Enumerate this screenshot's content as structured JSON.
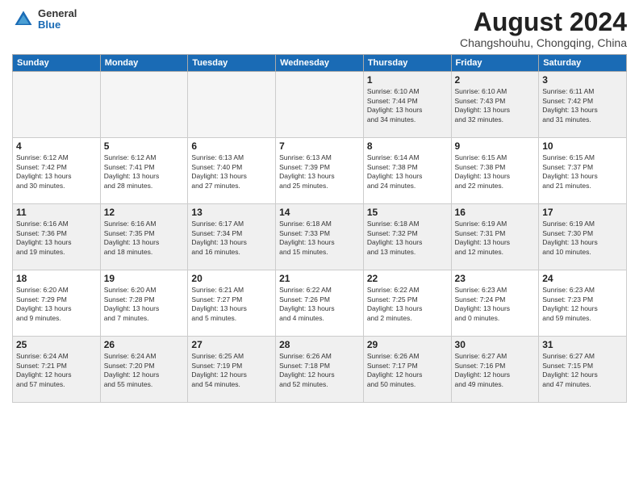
{
  "logo": {
    "general": "General",
    "blue": "Blue"
  },
  "title": "August 2024",
  "subtitle": "Changshouhu, Chongqing, China",
  "days_of_week": [
    "Sunday",
    "Monday",
    "Tuesday",
    "Wednesday",
    "Thursday",
    "Friday",
    "Saturday"
  ],
  "weeks": [
    {
      "id": "week1",
      "days": [
        {
          "num": "",
          "info": "",
          "empty": true
        },
        {
          "num": "",
          "info": "",
          "empty": true
        },
        {
          "num": "",
          "info": "",
          "empty": true
        },
        {
          "num": "",
          "info": "",
          "empty": true
        },
        {
          "num": "1",
          "info": "Sunrise: 6:10 AM\nSunset: 7:44 PM\nDaylight: 13 hours\nand 34 minutes.",
          "empty": false
        },
        {
          "num": "2",
          "info": "Sunrise: 6:10 AM\nSunset: 7:43 PM\nDaylight: 13 hours\nand 32 minutes.",
          "empty": false
        },
        {
          "num": "3",
          "info": "Sunrise: 6:11 AM\nSunset: 7:42 PM\nDaylight: 13 hours\nand 31 minutes.",
          "empty": false
        }
      ]
    },
    {
      "id": "week2",
      "days": [
        {
          "num": "4",
          "info": "Sunrise: 6:12 AM\nSunset: 7:42 PM\nDaylight: 13 hours\nand 30 minutes.",
          "empty": false
        },
        {
          "num": "5",
          "info": "Sunrise: 6:12 AM\nSunset: 7:41 PM\nDaylight: 13 hours\nand 28 minutes.",
          "empty": false
        },
        {
          "num": "6",
          "info": "Sunrise: 6:13 AM\nSunset: 7:40 PM\nDaylight: 13 hours\nand 27 minutes.",
          "empty": false
        },
        {
          "num": "7",
          "info": "Sunrise: 6:13 AM\nSunset: 7:39 PM\nDaylight: 13 hours\nand 25 minutes.",
          "empty": false
        },
        {
          "num": "8",
          "info": "Sunrise: 6:14 AM\nSunset: 7:38 PM\nDaylight: 13 hours\nand 24 minutes.",
          "empty": false
        },
        {
          "num": "9",
          "info": "Sunrise: 6:15 AM\nSunset: 7:38 PM\nDaylight: 13 hours\nand 22 minutes.",
          "empty": false
        },
        {
          "num": "10",
          "info": "Sunrise: 6:15 AM\nSunset: 7:37 PM\nDaylight: 13 hours\nand 21 minutes.",
          "empty": false
        }
      ]
    },
    {
      "id": "week3",
      "days": [
        {
          "num": "11",
          "info": "Sunrise: 6:16 AM\nSunset: 7:36 PM\nDaylight: 13 hours\nand 19 minutes.",
          "empty": false
        },
        {
          "num": "12",
          "info": "Sunrise: 6:16 AM\nSunset: 7:35 PM\nDaylight: 13 hours\nand 18 minutes.",
          "empty": false
        },
        {
          "num": "13",
          "info": "Sunrise: 6:17 AM\nSunset: 7:34 PM\nDaylight: 13 hours\nand 16 minutes.",
          "empty": false
        },
        {
          "num": "14",
          "info": "Sunrise: 6:18 AM\nSunset: 7:33 PM\nDaylight: 13 hours\nand 15 minutes.",
          "empty": false
        },
        {
          "num": "15",
          "info": "Sunrise: 6:18 AM\nSunset: 7:32 PM\nDaylight: 13 hours\nand 13 minutes.",
          "empty": false
        },
        {
          "num": "16",
          "info": "Sunrise: 6:19 AM\nSunset: 7:31 PM\nDaylight: 13 hours\nand 12 minutes.",
          "empty": false
        },
        {
          "num": "17",
          "info": "Sunrise: 6:19 AM\nSunset: 7:30 PM\nDaylight: 13 hours\nand 10 minutes.",
          "empty": false
        }
      ]
    },
    {
      "id": "week4",
      "days": [
        {
          "num": "18",
          "info": "Sunrise: 6:20 AM\nSunset: 7:29 PM\nDaylight: 13 hours\nand 9 minutes.",
          "empty": false
        },
        {
          "num": "19",
          "info": "Sunrise: 6:20 AM\nSunset: 7:28 PM\nDaylight: 13 hours\nand 7 minutes.",
          "empty": false
        },
        {
          "num": "20",
          "info": "Sunrise: 6:21 AM\nSunset: 7:27 PM\nDaylight: 13 hours\nand 5 minutes.",
          "empty": false
        },
        {
          "num": "21",
          "info": "Sunrise: 6:22 AM\nSunset: 7:26 PM\nDaylight: 13 hours\nand 4 minutes.",
          "empty": false
        },
        {
          "num": "22",
          "info": "Sunrise: 6:22 AM\nSunset: 7:25 PM\nDaylight: 13 hours\nand 2 minutes.",
          "empty": false
        },
        {
          "num": "23",
          "info": "Sunrise: 6:23 AM\nSunset: 7:24 PM\nDaylight: 13 hours\nand 0 minutes.",
          "empty": false
        },
        {
          "num": "24",
          "info": "Sunrise: 6:23 AM\nSunset: 7:23 PM\nDaylight: 12 hours\nand 59 minutes.",
          "empty": false
        }
      ]
    },
    {
      "id": "week5",
      "days": [
        {
          "num": "25",
          "info": "Sunrise: 6:24 AM\nSunset: 7:21 PM\nDaylight: 12 hours\nand 57 minutes.",
          "empty": false
        },
        {
          "num": "26",
          "info": "Sunrise: 6:24 AM\nSunset: 7:20 PM\nDaylight: 12 hours\nand 55 minutes.",
          "empty": false
        },
        {
          "num": "27",
          "info": "Sunrise: 6:25 AM\nSunset: 7:19 PM\nDaylight: 12 hours\nand 54 minutes.",
          "empty": false
        },
        {
          "num": "28",
          "info": "Sunrise: 6:26 AM\nSunset: 7:18 PM\nDaylight: 12 hours\nand 52 minutes.",
          "empty": false
        },
        {
          "num": "29",
          "info": "Sunrise: 6:26 AM\nSunset: 7:17 PM\nDaylight: 12 hours\nand 50 minutes.",
          "empty": false
        },
        {
          "num": "30",
          "info": "Sunrise: 6:27 AM\nSunset: 7:16 PM\nDaylight: 12 hours\nand 49 minutes.",
          "empty": false
        },
        {
          "num": "31",
          "info": "Sunrise: 6:27 AM\nSunset: 7:15 PM\nDaylight: 12 hours\nand 47 minutes.",
          "empty": false
        }
      ]
    }
  ]
}
